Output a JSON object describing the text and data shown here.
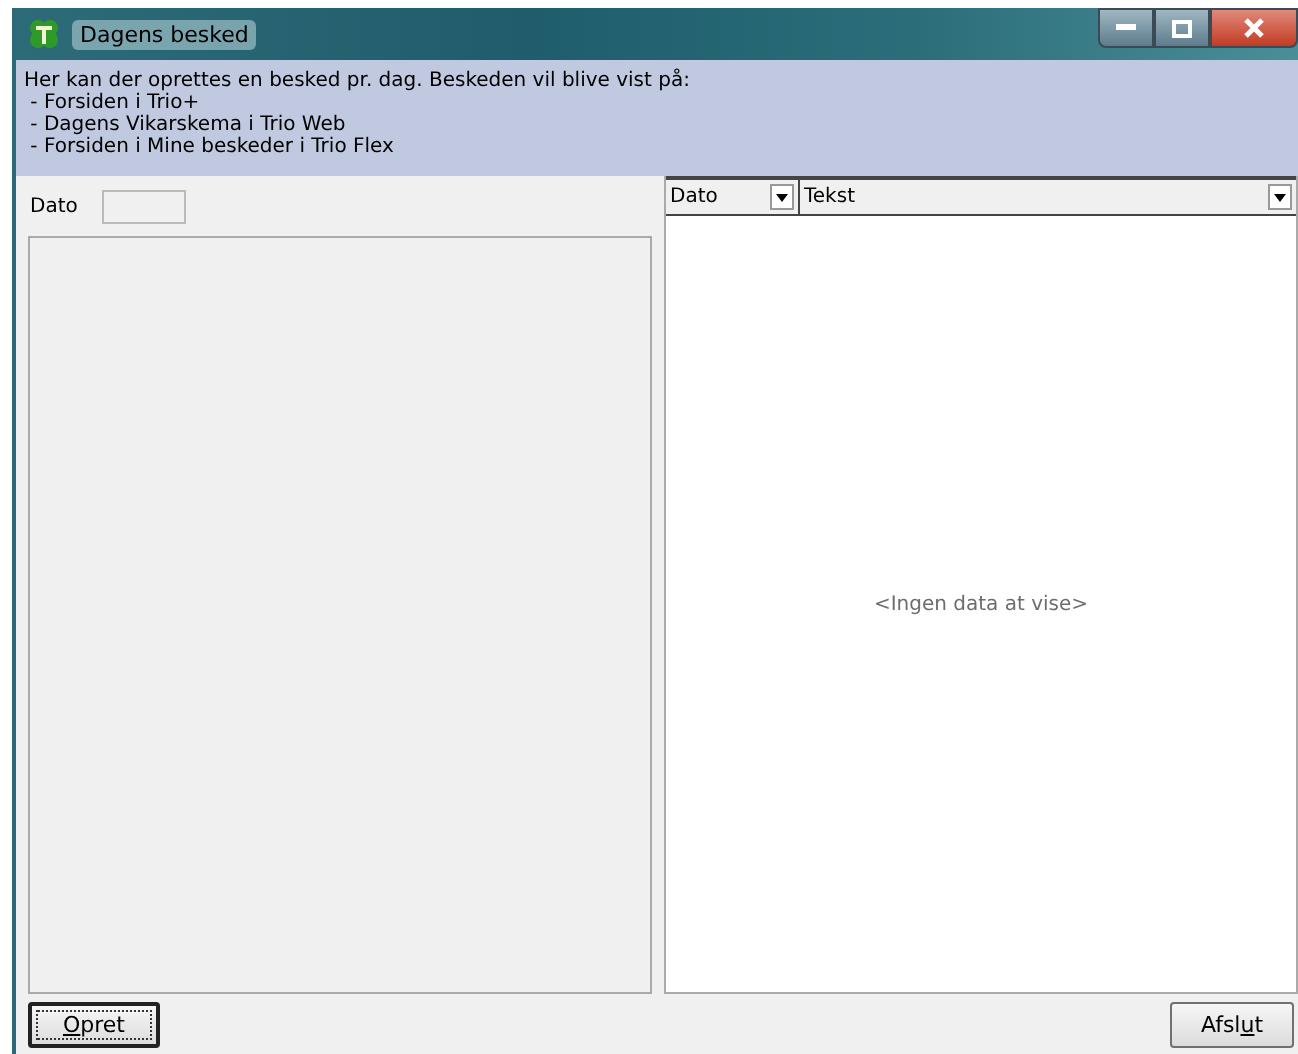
{
  "window": {
    "title": "Dagens besked"
  },
  "info": {
    "intro": "Her kan der oprettes en besked pr. dag. Beskeden vil blive vist på:",
    "lines": [
      "- Forsiden i Trio+",
      "- Dagens Vikarskema i Trio Web",
      "- Forsiden i Mine beskeder i Trio Flex"
    ]
  },
  "date_field": {
    "label": "Dato"
  },
  "grid": {
    "columns": [
      {
        "label": "Dato"
      },
      {
        "label": "Tekst"
      }
    ],
    "empty_text": "<Ingen data at vise>"
  },
  "buttons": [
    {
      "key": "O",
      "after": "pret",
      "focused": true
    },
    {
      "before": "Afsl",
      "key": "u",
      "after": "t",
      "focused": false
    }
  ]
}
